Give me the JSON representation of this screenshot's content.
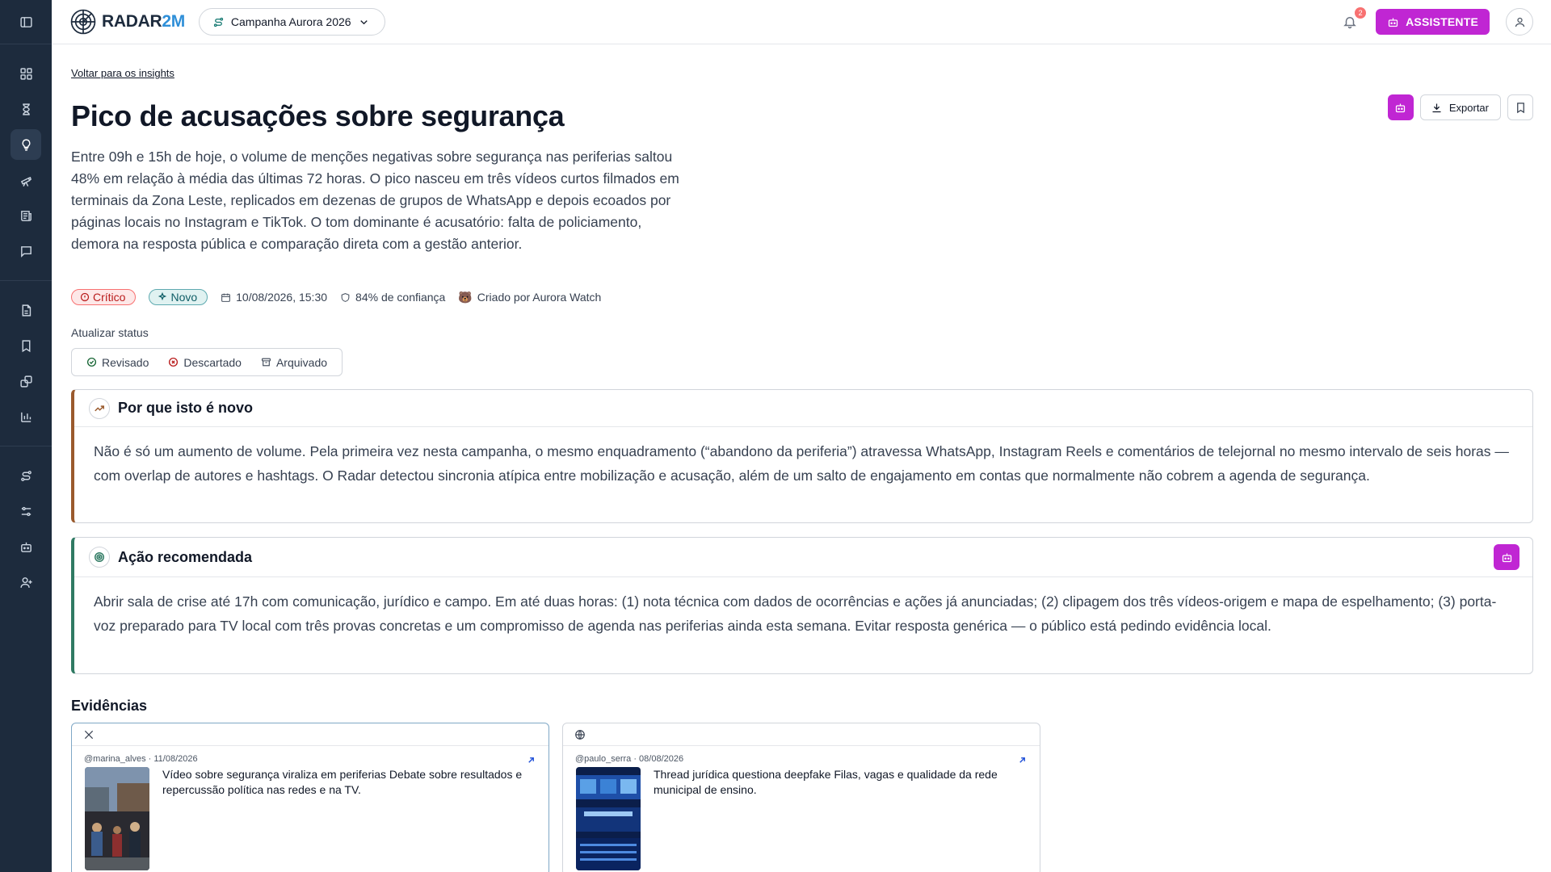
{
  "app": {
    "name_main": "RADAR",
    "name_accent": "2M"
  },
  "header": {
    "campaign": "Campanha Aurora 2026",
    "notification_count": "2",
    "assistant_label": "ASSISTENTE"
  },
  "sidebar": {
    "items": [
      {
        "icon": "toggle-sidebar-icon"
      },
      {
        "icon": "dashboard-icon"
      },
      {
        "icon": "hourglass-icon"
      },
      {
        "icon": "lightbulb-icon",
        "active": true
      },
      {
        "icon": "telescope-icon"
      },
      {
        "icon": "newspaper-icon"
      },
      {
        "icon": "chat-icon"
      },
      {
        "icon": "document-icon"
      },
      {
        "icon": "bookmark-icon"
      },
      {
        "icon": "links-icon"
      },
      {
        "icon": "bar-chart-icon"
      },
      {
        "icon": "route-icon"
      },
      {
        "icon": "filters-icon"
      },
      {
        "icon": "bot-icon"
      },
      {
        "icon": "add-user-icon"
      }
    ]
  },
  "page": {
    "back_link": "Voltar para os insights",
    "title": "Pico de acusações sobre segurança",
    "summary": "Entre 09h e 15h de hoje, o volume de menções negativas sobre segurança nas periferias saltou 48% em relação à média das últimas 72 horas. O pico nasceu em três vídeos curtos filmados em terminais da Zona Leste, replicados em dezenas de grupos de WhatsApp e depois ecoados por páginas locais no Instagram e TikTok. O tom dominante é acusatório: falta de policiamento, demora na resposta pública e comparação direta com a gestão anterior.",
    "export_label": "Exportar",
    "meta": {
      "severity": "Crítico",
      "state": "Novo",
      "datetime": "10/08/2026, 15:30",
      "confidence": "84% de confiança",
      "creator": "Criado por Aurora Watch",
      "creator_emoji": "🐻"
    },
    "status": {
      "label": "Atualizar status",
      "options": [
        "Revisado",
        "Descartado",
        "Arquivado"
      ]
    }
  },
  "why_new": {
    "title": "Por que isto é novo",
    "body": "Não é só um aumento de volume. Pela primeira vez nesta campanha, o mesmo enquadramento (“abandono da periferia”) atravessa WhatsApp, Instagram Reels e comentários de telejornal no mesmo intervalo de seis horas — com overlap de autores e hashtags. O Radar detectou sincronia atípica entre mobilização e acusação, além de um salto de engajamento em contas que normalmente não cobrem a agenda de segurança."
  },
  "action": {
    "title": "Ação recomendada",
    "body": "Abrir sala de crise até 17h com comunicação, jurídico e campo. Em até duas horas: (1) nota técnica com dados de ocorrências e ações já anunciadas; (2) clipagem dos três vídeos-origem e mapa de espelhamento; (3) porta-voz preparado para TV local com três provas concretas e um compromisso de agenda nas periferias ainda esta semana. Evitar resposta genérica — o público está pedindo evidência local."
  },
  "evidence": {
    "title": "Evidências",
    "items": [
      {
        "source_icon": "x-logo-icon",
        "meta": "@marina_alves · 11/08/2026",
        "text": "Vídeo sobre segurança viraliza em periferias Debate sobre resultados e repercussão política nas redes e na TV."
      },
      {
        "source_icon": "globe-icon",
        "meta": "@paulo_serra · 08/08/2026",
        "text": "Thread jurídica questiona deepfake Filas, vagas e qualidade da rede municipal de ensino."
      }
    ]
  },
  "colors": {
    "sidebar": "#1d2b3d",
    "accent_magenta": "#c026d3",
    "critical": "#b91c1c",
    "new": "#0f5e66",
    "why_border": "#9a5a2d",
    "action_border": "#2f7a63"
  }
}
